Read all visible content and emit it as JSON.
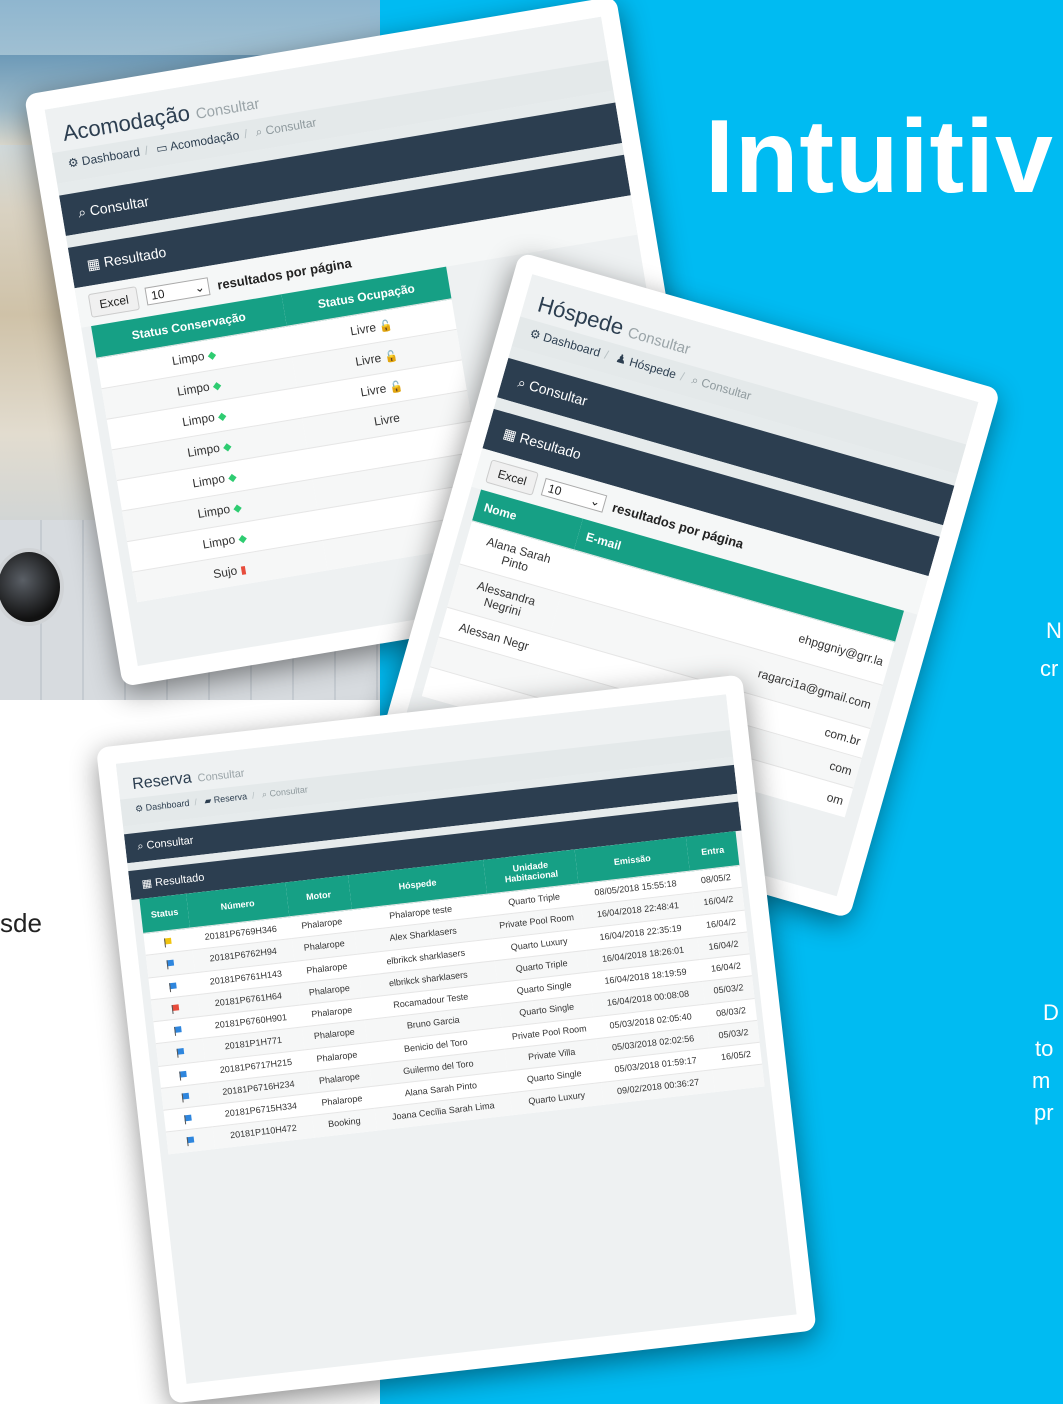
{
  "hero": {
    "title": "Intuitiv"
  },
  "side_texts": {
    "t1": "N",
    "t2": "cr",
    "t3": "D",
    "t4": "to",
    "t5": "m",
    "t6": "pr"
  },
  "left_text": "sde",
  "acomodacao": {
    "title": "Acomodação",
    "subtitle": "Consultar",
    "crumbs": [
      "Dashboard",
      "Acomodação",
      "Consultar"
    ],
    "panel_consultar": "Consultar",
    "panel_resultado": "Resultado",
    "excel_label": "Excel",
    "per_page_value": "10",
    "per_page_label": "resultados por página",
    "columns": [
      "Status Conservação",
      "Status Ocupação"
    ],
    "rows": [
      [
        "Limpo",
        "Livre"
      ],
      [
        "Limpo",
        "Livre"
      ],
      [
        "Limpo",
        "Livre"
      ],
      [
        "Limpo",
        "Livre"
      ],
      [
        "Limpo",
        ""
      ],
      [
        "Limpo",
        ""
      ],
      [
        "Limpo",
        ""
      ],
      [
        "Sujo",
        ""
      ]
    ]
  },
  "hospede": {
    "title": "Hóspede",
    "subtitle": "Consultar",
    "crumbs": [
      "Dashboard",
      "Hóspede",
      "Consultar"
    ],
    "panel_consultar": "Consultar",
    "panel_resultado": "Resultado",
    "excel_label": "Excel",
    "per_page_value": "10",
    "per_page_label": "resultados por página",
    "columns": [
      "Nome",
      "E-mail"
    ],
    "rows": [
      [
        "Alana Sarah Pinto",
        "ehpggniy@grr.la"
      ],
      [
        "Alessandra Negrini",
        "ragarci1a@gmail.com"
      ],
      [
        "Alessan Negr",
        "com.br"
      ],
      [
        "",
        "com"
      ],
      [
        "",
        "om"
      ]
    ]
  },
  "reserva": {
    "title": "Reserva",
    "subtitle": "Consultar",
    "crumbs": [
      "Dashboard",
      "Reserva",
      "Consultar"
    ],
    "panel_consultar": "Consultar",
    "panel_resultado": "Resultado",
    "columns": [
      "Status",
      "Número",
      "Motor",
      "Hóspede",
      "Unidade Habitacional",
      "Emissão",
      "Entra"
    ],
    "rows": [
      {
        "flag": "#f1c40f",
        "numero": "20181P6769H346",
        "motor": "Phalarope",
        "hospede": "Phalarope teste",
        "unidade": "Quarto Triple",
        "emissao": "08/05/2018 15:55:18",
        "entrada": "08/05/2"
      },
      {
        "flag": "#2e86de",
        "numero": "20181P6762H94",
        "motor": "Phalarope",
        "hospede": "Alex Sharklasers",
        "unidade": "Private Pool Room",
        "emissao": "16/04/2018 22:48:41",
        "entrada": "16/04/2"
      },
      {
        "flag": "#2e86de",
        "numero": "20181P6761H143",
        "motor": "Phalarope",
        "hospede": "elbrikck sharklasers",
        "unidade": "Quarto Luxury",
        "emissao": "16/04/2018 22:35:19",
        "entrada": "16/04/2"
      },
      {
        "flag": "#e74c3c",
        "numero": "20181P6761H64",
        "motor": "Phalarope",
        "hospede": "elbrikck sharklasers",
        "unidade": "Quarto Triple",
        "emissao": "16/04/2018 18:26:01",
        "entrada": "16/04/2"
      },
      {
        "flag": "#2e86de",
        "numero": "20181P6760H901",
        "motor": "Phalarope",
        "hospede": "Rocamadour Teste",
        "unidade": "Quarto Single",
        "emissao": "16/04/2018 18:19:59",
        "entrada": "16/04/2"
      },
      {
        "flag": "#2e86de",
        "numero": "20181P1H771",
        "motor": "Phalarope",
        "hospede": "Bruno Garcia",
        "unidade": "Quarto Single",
        "emissao": "16/04/2018 00:08:08",
        "entrada": "05/03/2"
      },
      {
        "flag": "#2e86de",
        "numero": "20181P6717H215",
        "motor": "Phalarope",
        "hospede": "Benicio del Toro",
        "unidade": "Private Pool Room",
        "emissao": "05/03/2018 02:05:40",
        "entrada": "08/03/2"
      },
      {
        "flag": "#2e86de",
        "numero": "20181P6716H234",
        "motor": "Phalarope",
        "hospede": "Guilermo del Toro",
        "unidade": "Private Villa",
        "emissao": "05/03/2018 02:02:56",
        "entrada": "05/03/2"
      },
      {
        "flag": "#2e86de",
        "numero": "20181P6715H334",
        "motor": "Phalarope",
        "hospede": "Alana Sarah Pinto",
        "unidade": "Quarto Single",
        "emissao": "05/03/2018 01:59:17",
        "entrada": "16/05/2"
      },
      {
        "flag": "#2e86de",
        "numero": "20181P110H472",
        "motor": "Booking",
        "hospede": "Joana Cecília Sarah Lima",
        "unidade": "Quarto Luxury",
        "emissao": "09/02/2018 00:36:27",
        "entrada": ""
      }
    ]
  },
  "colors": {
    "accent_blue": "#00bbf2",
    "table_header": "#16a085",
    "dark_bar": "#2c3e50"
  }
}
